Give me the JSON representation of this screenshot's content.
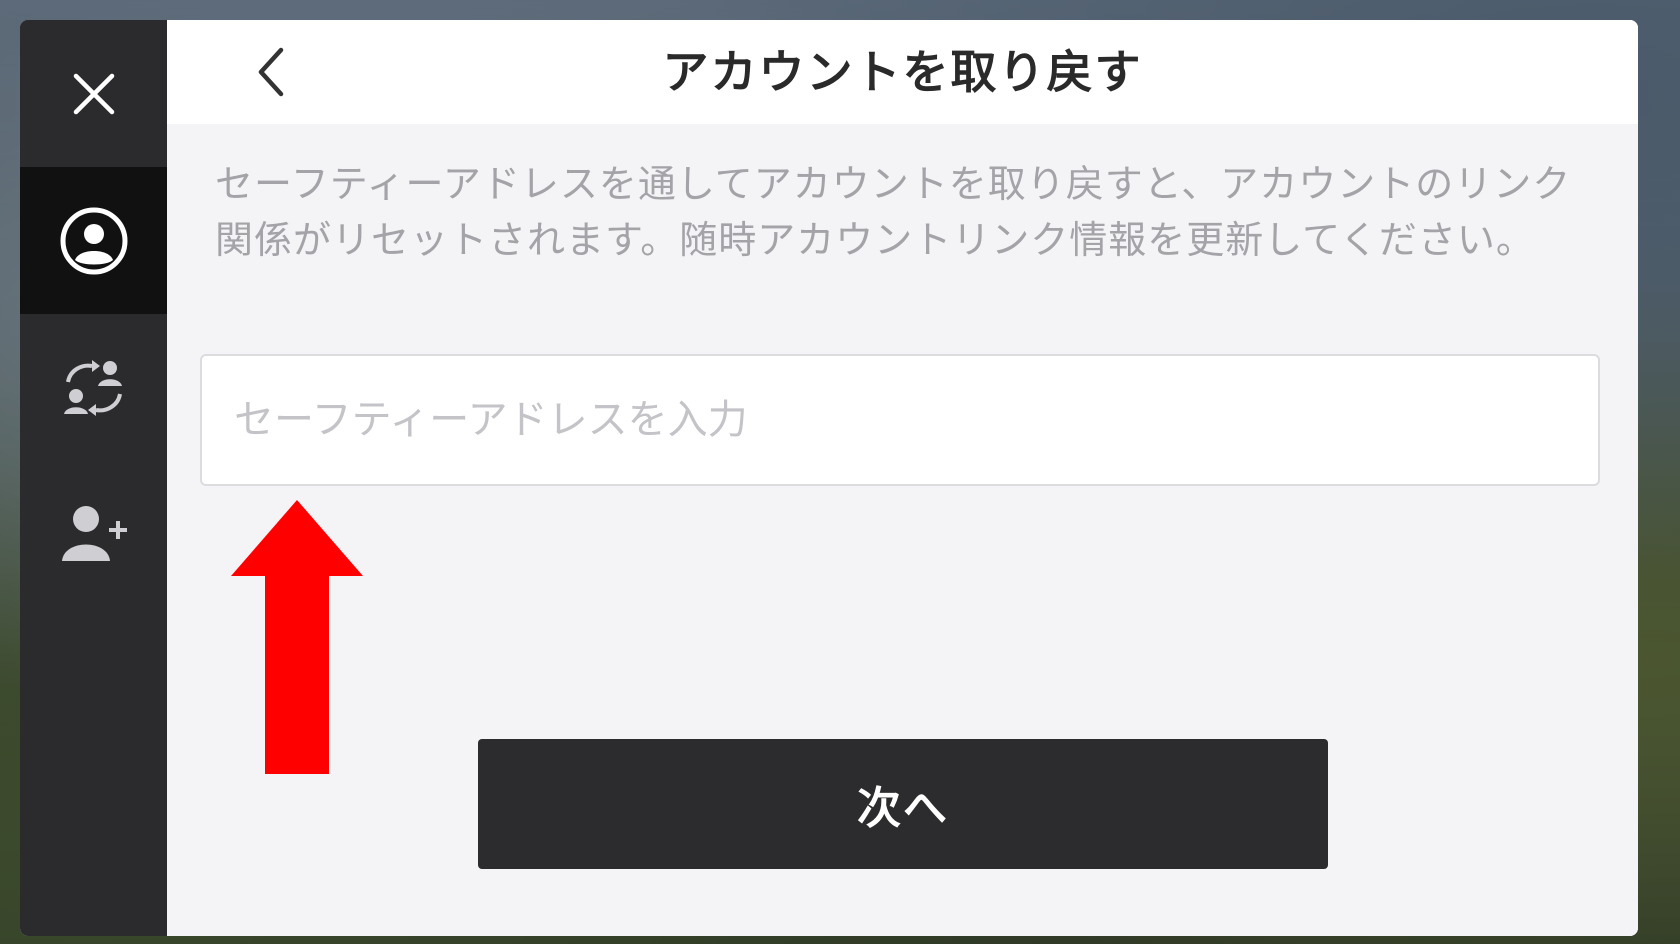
{
  "dialog": {
    "title": "アカウントを取り戻す",
    "description": "セーフティーアドレスを通してアカウントを取り戻すと、アカウントのリンク関係がリセットされます。随時アカウントリンク情報を更新してください。",
    "input": {
      "placeholder": "セーフティーアドレスを入力",
      "value": ""
    },
    "next_label": "次へ"
  },
  "sidebar": {
    "items": [
      {
        "icon": "close-icon",
        "active": false
      },
      {
        "icon": "account-icon",
        "active": true
      },
      {
        "icon": "switch-account-icon",
        "active": false
      },
      {
        "icon": "add-user-icon",
        "active": false
      }
    ]
  },
  "header": {
    "back_icon": "chevron-left-icon"
  },
  "annotation": {
    "arrow_icon": "red-arrow-up-icon",
    "color": "#ff0000"
  },
  "colors": {
    "sidebar_bg": "#2b2b2d",
    "sidebar_active_bg": "#111112",
    "panel_bg": "#f4f4f6",
    "button_bg": "#2c2c2e"
  }
}
